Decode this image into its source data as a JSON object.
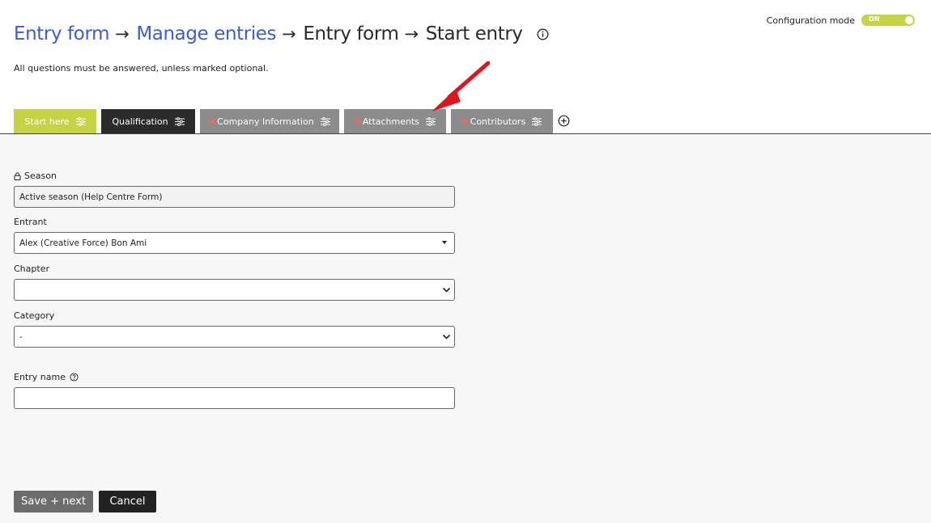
{
  "breadcrumb": {
    "items": [
      "Entry form",
      "Manage entries",
      "Entry form",
      "Start entry"
    ],
    "separator": "→"
  },
  "subtitle": "All questions must be answered, unless marked optional.",
  "config": {
    "label": "Configuration mode",
    "toggle_state": "ON"
  },
  "tabs": [
    {
      "label": "Start here"
    },
    {
      "label": "Qualification"
    },
    {
      "label": "Company Information"
    },
    {
      "label": "Attachments"
    },
    {
      "label": "Contributors"
    }
  ],
  "form": {
    "season": {
      "label": "Season",
      "value": "Active season (Help Centre Form)"
    },
    "entrant": {
      "label": "Entrant",
      "value": "Alex (Creative Force) Bon Ami"
    },
    "chapter": {
      "label": "Chapter",
      "value": ""
    },
    "category": {
      "label": "Category",
      "value": "-"
    },
    "entry_name": {
      "label": "Entry name",
      "value": ""
    }
  },
  "buttons": {
    "save_next": "Save + next",
    "cancel": "Cancel"
  },
  "colors": {
    "accent": "#c5d345",
    "link": "#3d5bd9",
    "annotation_arrow": "#e0141b"
  }
}
